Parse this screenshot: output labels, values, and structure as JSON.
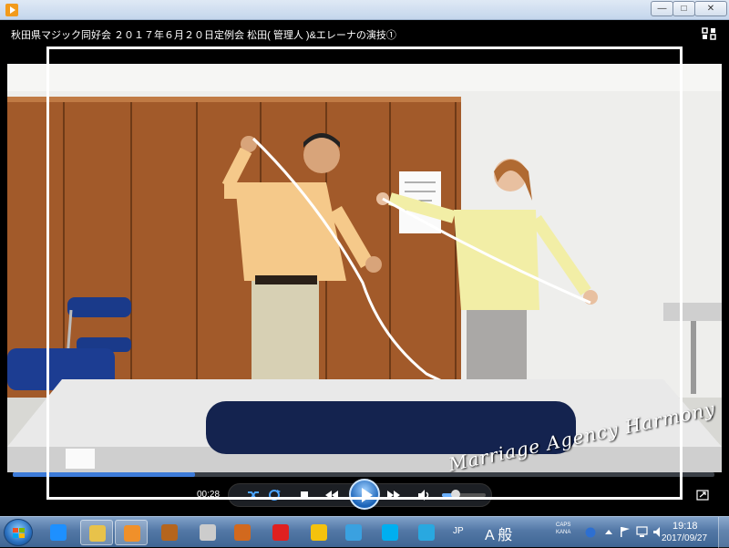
{
  "window": {
    "video_title": "秋田県マジック同好会 ２０１７年６月２０日定例会 松田( 管理人 )&エレーナの演技①",
    "minimize_glyph": "—",
    "maximize_glyph": "□",
    "close_glyph": "✕"
  },
  "player": {
    "elapsed_time": "00:28",
    "progress": 0.26,
    "volume": 0.3,
    "watermark": "Marriage Agency Harmony"
  },
  "taskbar": {
    "language": "JP",
    "ime_mode": "A 般",
    "caps": "CAPS",
    "kana": "KANA",
    "clock_time": "19:18",
    "clock_date": "2017/09/27",
    "apps": [
      {
        "name": "internet-explorer",
        "color": "#1e90ff"
      },
      {
        "name": "file-explorer",
        "color": "#e8c24a"
      },
      {
        "name": "media-player",
        "color": "#f0902a"
      },
      {
        "name": "app-4",
        "color": "#b5651d"
      },
      {
        "name": "app-5",
        "color": "#cccccc"
      },
      {
        "name": "app-6",
        "color": "#d2691e"
      },
      {
        "name": "app-7",
        "color": "#e02020"
      },
      {
        "name": "app-8",
        "color": "#f4c20d"
      },
      {
        "name": "paint",
        "color": "#3aa1e0"
      },
      {
        "name": "skype",
        "color": "#00aff0"
      },
      {
        "name": "chat",
        "color": "#29a8e0"
      }
    ]
  }
}
